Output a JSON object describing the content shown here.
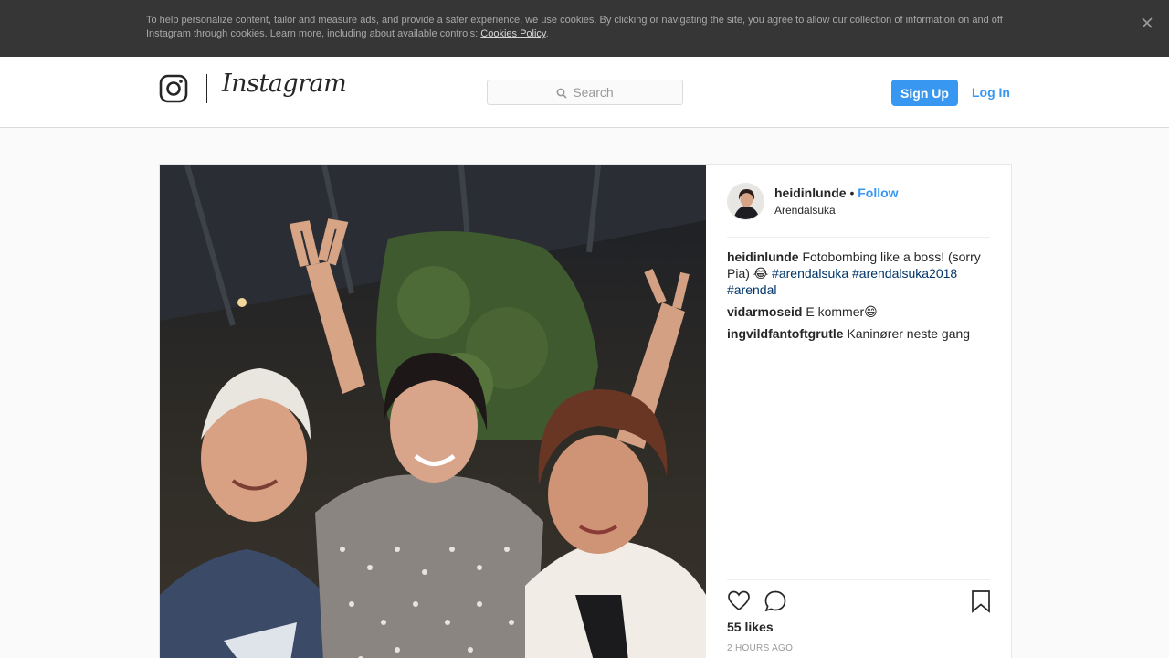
{
  "cookie_banner": {
    "text": "To help personalize content, tailor and measure ads, and provide a safer experience, we use cookies. By clicking or navigating the site, you agree to allow our collection of information on and off Instagram through cookies. Learn more, including about available controls: ",
    "link_label": "Cookies Policy",
    "trailing": ".",
    "close_icon": "close-icon"
  },
  "header": {
    "wordmark": "Instagram",
    "logo_icon": "instagram-glyph-icon",
    "search_placeholder": "Search",
    "search_icon": "search-icon",
    "signup_label": "Sign Up",
    "login_label": "Log In"
  },
  "post": {
    "author": "heidinlunde",
    "separator": "•",
    "follow_label": "Follow",
    "location": "Arendalsuka",
    "caption": {
      "user": "heidinlunde",
      "text": "Fotobombing like a boss! (sorry Pia) 😂",
      "tags": [
        "#arendalsuka",
        "#arendalsuka2018",
        "#arendal"
      ]
    },
    "comments": [
      {
        "user": "vidarmoseid",
        "text": "E kommer😄"
      },
      {
        "user": "ingvildfantoftgrutle",
        "text": "Kaninører neste gang"
      }
    ],
    "actions": {
      "like_icon": "heart-icon",
      "comment_icon": "comment-icon",
      "save_icon": "bookmark-icon"
    },
    "likes": "55 likes",
    "timestamp": "2 hours ago"
  },
  "colors": {
    "accent": "#3897f0",
    "hashtag": "#003569",
    "banner_bg": "#363636",
    "border": "#dbdbdb"
  }
}
